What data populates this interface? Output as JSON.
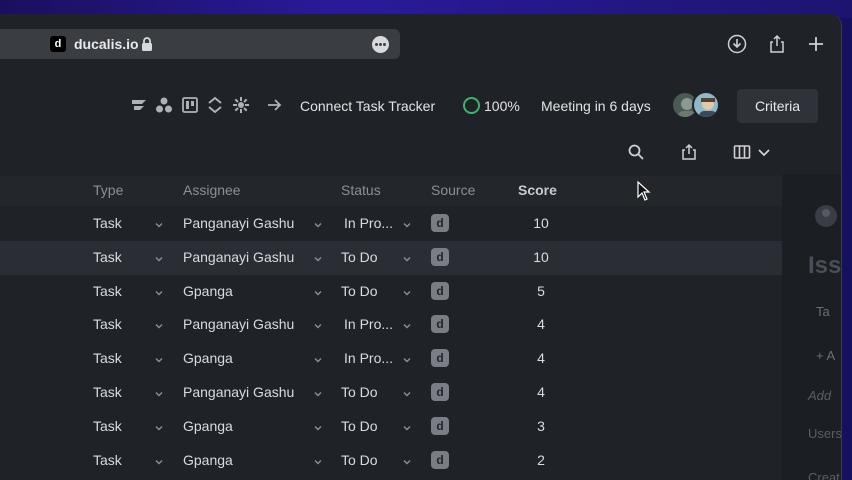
{
  "browser": {
    "favicon_letter": "d",
    "url": "ducalis.io"
  },
  "header": {
    "connect_label": "Connect Task Tracker",
    "progress": "100%",
    "meeting": "Meeting in 6 days",
    "criteria_label": "Criteria"
  },
  "table": {
    "columns": [
      "Type",
      "Assignee",
      "Status",
      "Source",
      "Score"
    ],
    "rows": [
      {
        "type": "Task",
        "assignee": "Panganayi Gashu",
        "status": "In Pro...",
        "source": "d",
        "score": "10"
      },
      {
        "type": "Task",
        "assignee": "Panganayi Gashu",
        "status": "To Do",
        "source": "d",
        "score": "10"
      },
      {
        "type": "Task",
        "assignee": "Gpanga",
        "status": "To Do",
        "source": "d",
        "score": "5"
      },
      {
        "type": "Task",
        "assignee": "Panganayi Gashu",
        "status": "In Pro...",
        "source": "d",
        "score": "4"
      },
      {
        "type": "Task",
        "assignee": "Gpanga",
        "status": "In Pro...",
        "source": "d",
        "score": "4"
      },
      {
        "type": "Task",
        "assignee": "Panganayi Gashu",
        "status": "To Do",
        "source": "d",
        "score": "4"
      },
      {
        "type": "Task",
        "assignee": "Gpanga",
        "status": "To Do",
        "source": "d",
        "score": "3"
      },
      {
        "type": "Task",
        "assignee": "Gpanga",
        "status": "To Do",
        "source": "d",
        "score": "2"
      }
    ]
  },
  "right_panel": {
    "title": "Iss",
    "tag": "Ta",
    "add": "A",
    "add_placeholder": "Add",
    "users": "Users",
    "created": "Creat"
  },
  "colors": {
    "accent_green": "#3cb56b",
    "background": "#1f2227"
  }
}
